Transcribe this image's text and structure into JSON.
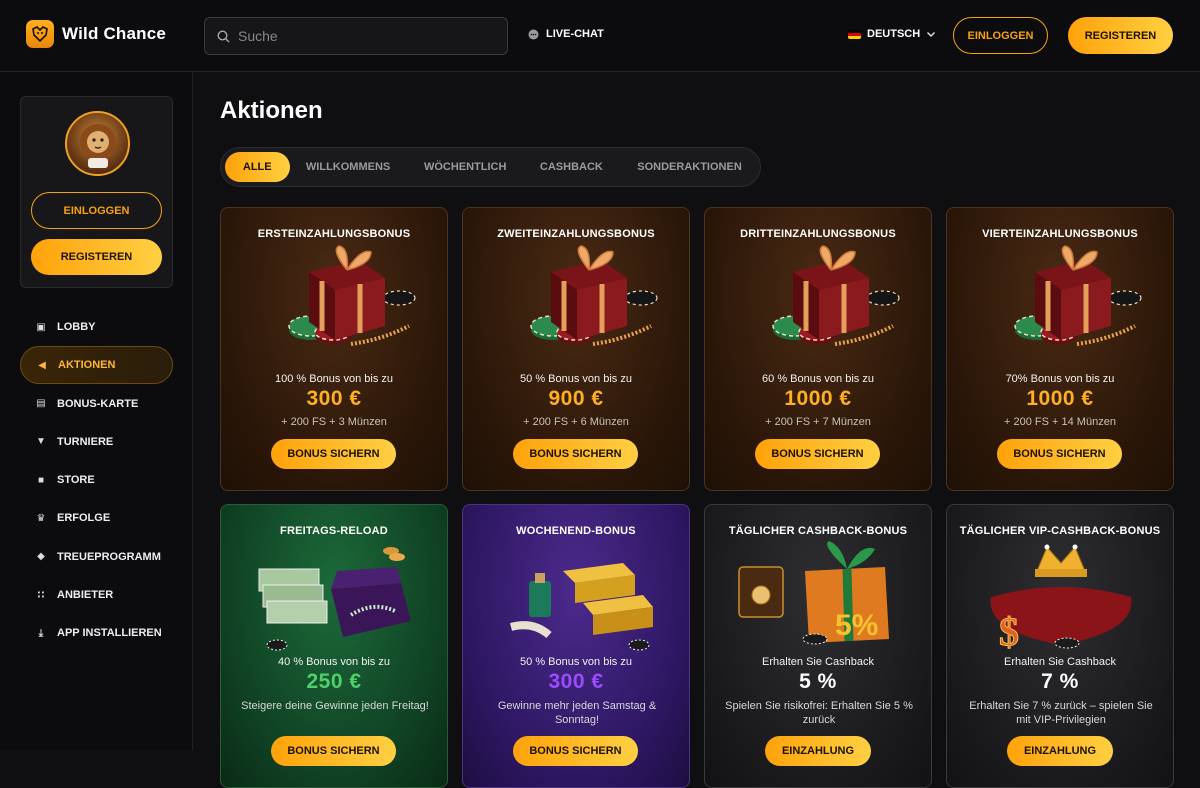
{
  "header": {
    "logo_text": "Wild Chance",
    "search_placeholder": "Suche",
    "live_chat": "LIVE-CHAT",
    "language": "DEUTSCH",
    "login": "EINLOGGEN",
    "register": "REGISTEREN"
  },
  "sidebar": {
    "login": "EINLOGGEN",
    "register": "REGISTEREN",
    "items": [
      {
        "label": "LOBBY",
        "icon": "cube-icon"
      },
      {
        "label": "AKTIONEN",
        "icon": "megaphone-icon",
        "active": true
      },
      {
        "label": "BONUS-KARTE",
        "icon": "map-icon"
      },
      {
        "label": "TURNIERE",
        "icon": "trophy-icon"
      },
      {
        "label": "STORE",
        "icon": "store-icon"
      },
      {
        "label": "ERFOLGE",
        "icon": "crown-icon"
      },
      {
        "label": "TREUEPROGRAMM",
        "icon": "diamond-icon"
      },
      {
        "label": "ANBIETER",
        "icon": "grid-icon"
      },
      {
        "label": "APP INSTALLIEREN",
        "icon": "download-icon"
      }
    ]
  },
  "main": {
    "title": "Aktionen",
    "tabs": [
      "ALLE",
      "WILLKOMMENS",
      "WÖCHENTLICH",
      "CASHBACK",
      "SONDERAKTIONEN"
    ],
    "cards": [
      {
        "title": "ERSTEINZAHLUNGSBONUS",
        "desc": "100 % Bonus von bis zu",
        "amount": "300 €",
        "extra": "+ 200 FS + 3 Münzen",
        "button": "BONUS SICHERN",
        "theme": "brown",
        "amount_color": "#ffb020",
        "art": "gift-icon"
      },
      {
        "title": "ZWEITEINZAHLUNGSBONUS",
        "desc": "50 % Bonus von bis zu",
        "amount": "900 €",
        "extra": "+ 200 FS + 6 Münzen",
        "button": "BONUS SICHERN",
        "theme": "brown",
        "amount_color": "#ffb020",
        "art": "gift-icon"
      },
      {
        "title": "DRITTEINZAHLUNGSBONUS",
        "desc": "60 % Bonus von bis zu",
        "amount": "1000 €",
        "extra": "+ 200 FS + 7 Münzen",
        "button": "BONUS SICHERN",
        "theme": "brown",
        "amount_color": "#ffb020",
        "art": "gift-icon"
      },
      {
        "title": "VIERTEINZAHLUNGSBONUS",
        "desc": "70% Bonus von bis zu",
        "amount": "1000 €",
        "extra": "+ 200 FS + 14 Münzen",
        "button": "BONUS SICHERN",
        "theme": "brown",
        "amount_color": "#ffb020",
        "art": "gift-icon"
      },
      {
        "title": "FREITAGS-RELOAD",
        "desc": "40 % Bonus von bis zu",
        "amount": "250 €",
        "note": "Steigere deine Gewinne jeden Freitag!",
        "button": "BONUS SICHERN",
        "theme": "green",
        "amount_color": "#4fd06a",
        "art": "money-jewelry-icon"
      },
      {
        "title": "WOCHENEND-BONUS",
        "desc": "50 % Bonus von bis zu",
        "amount": "300 €",
        "note": "Gewinne mehr jeden Samstag & Sonntag!",
        "button": "BONUS SICHERN",
        "theme": "purple",
        "amount_color": "#9a4cff",
        "art": "gold-bars-icon"
      },
      {
        "title": "TÄGLICHER CASHBACK-BONUS",
        "desc": "Erhalten Sie Cashback",
        "amount": "5 %",
        "note": "Spielen Sie risikofrei: Erhalten Sie 5 % zurück",
        "button": "EINZAHLUNG",
        "theme": "dark",
        "amount_color": "#ffffff",
        "art": "cashback-gift-icon"
      },
      {
        "title": "TÄGLICHER VIP-CASHBACK-BONUS",
        "desc": "Erhalten Sie Cashback",
        "amount": "7 %",
        "note": "Erhalten Sie 7 % zurück – spielen Sie mit VIP-Privilegien",
        "button": "EINZAHLUNG",
        "theme": "dark",
        "amount_color": "#ffffff",
        "art": "crown-pillow-icon"
      }
    ]
  }
}
